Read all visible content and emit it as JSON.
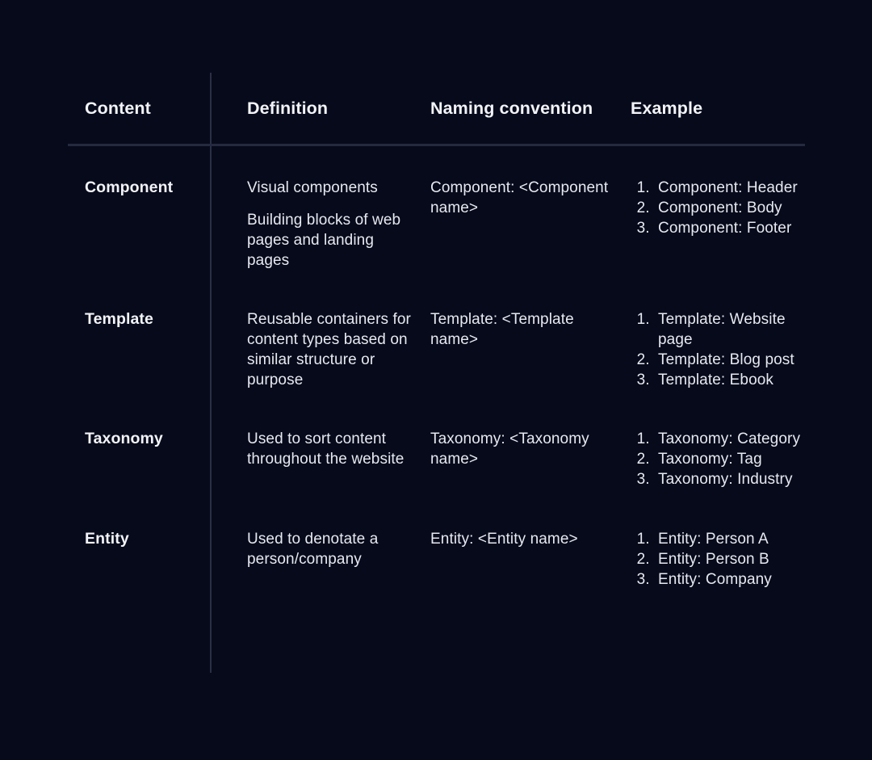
{
  "table": {
    "columns": [
      {
        "key": "content",
        "label": "Content"
      },
      {
        "key": "definition",
        "label": "Definition"
      },
      {
        "key": "naming",
        "label": "Naming convention"
      },
      {
        "key": "example",
        "label": "Example"
      }
    ],
    "rows": [
      {
        "content": "Component",
        "definition": [
          "Visual components",
          "Building blocks of web pages and landing pages"
        ],
        "naming": "Component: <Component name>",
        "examples": [
          "Component: Header",
          "Component: Body",
          "Component: Footer"
        ]
      },
      {
        "content": "Template",
        "definition": [
          "Reusable containers for content types based on similar structure or purpose"
        ],
        "naming": "Template: <Template name>",
        "examples": [
          "Template: Website page",
          "Template: Blog post",
          "Template: Ebook"
        ]
      },
      {
        "content": "Taxonomy",
        "definition": [
          "Used to sort content throughout the website"
        ],
        "naming": "Taxonomy: <Taxonomy name>",
        "examples": [
          "Taxonomy: Category",
          "Taxonomy: Tag",
          "Taxonomy: Industry"
        ]
      },
      {
        "content": "Entity",
        "definition": [
          "Used to denotate a person/company"
        ],
        "naming": "Entity: <Entity name>",
        "examples": [
          "Entity: Person A",
          "Entity: Person B",
          "Entity: Company"
        ]
      }
    ]
  },
  "colors": {
    "background": "#060a1a",
    "text": "#e7e9f1",
    "heading": "#f2f3f8",
    "rule": "#2b2f46"
  }
}
